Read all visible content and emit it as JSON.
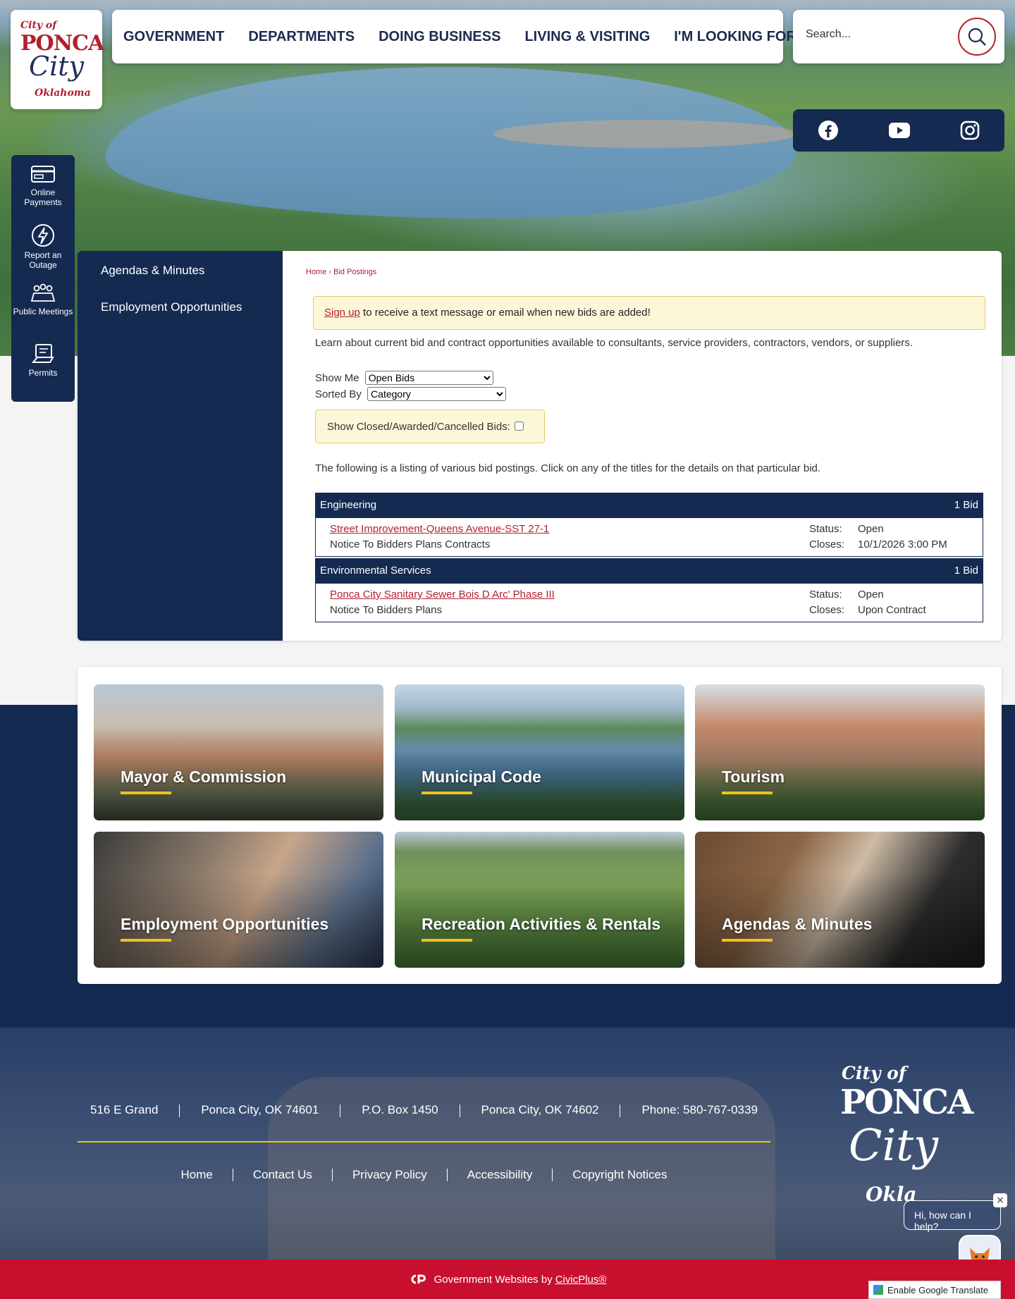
{
  "logo": {
    "line1": "City of",
    "line2": "PONCA",
    "line3": "City",
    "line4": "Oklahoma"
  },
  "nav": [
    "GOVERNMENT",
    "DEPARTMENTS",
    "DOING BUSINESS",
    "LIVING & VISITING",
    "I'M LOOKING FOR"
  ],
  "search": {
    "placeholder": "Search..."
  },
  "social": [
    "facebook-icon",
    "youtube-icon",
    "instagram-icon"
  ],
  "quick": [
    {
      "label": "Online Payments",
      "icon": "credit-card-icon"
    },
    {
      "label": "Report an Outage",
      "icon": "lightning-icon"
    },
    {
      "label": "Public Meetings",
      "icon": "meeting-icon"
    },
    {
      "label": "Permits",
      "icon": "permit-icon"
    }
  ],
  "sidenav": [
    "Agendas & Minutes",
    "Employment Opportunities"
  ],
  "breadcrumb": {
    "home": "Home",
    "sep": "›",
    "current": "Bid Postings"
  },
  "alert": {
    "link": "Sign up",
    "text": " to receive a text message or email when new bids are added!"
  },
  "intro": "Learn about current bid and contract opportunities available to consultants, service providers, contractors, vendors, or suppliers.",
  "controls": {
    "show_label": "Show Me",
    "show_value": "Open Bids",
    "sort_label": "Sorted By",
    "sort_value": "Category",
    "closed_label": "Show Closed/Awarded/Cancelled Bids:"
  },
  "listing_text": "The following is a listing of various bid postings. Click on any of the titles for the details on that particular bid.",
  "categories": [
    {
      "name": "Engineering",
      "count": "1 Bid",
      "bid": {
        "title": "Street Improvement-Queens Avenue-SST 27-1",
        "desc": "Notice To Bidders Plans Contracts",
        "status_label": "Status:",
        "status": "Open",
        "closes_label": "Closes:",
        "closes": "10/1/2026 3:00 PM"
      }
    },
    {
      "name": "Environmental Services",
      "count": "1 Bid",
      "bid": {
        "title": "Ponca City Sanitary Sewer Bois D Arc' Phase III",
        "desc": "Notice To Bidders Plans",
        "status_label": "Status:",
        "status": "Open",
        "closes_label": "Closes:",
        "closes": "Upon Contract"
      }
    }
  ],
  "tiles": [
    "Mayor & Commission",
    "Municipal Code",
    "Tourism",
    "Employment Opportunities",
    "Recreation Activities & Rentals",
    "Agendas & Minutes"
  ],
  "footer": {
    "address": [
      "516 E Grand",
      "Ponca City, OK 74601",
      "P.O. Box 1450",
      "Ponca City, OK 74602",
      "Phone: 580-767-0339"
    ],
    "links": [
      "Home",
      "Contact Us",
      "Privacy Policy",
      "Accessibility",
      "Copyright Notices"
    ],
    "logo": {
      "a": "City of",
      "b": "PONCA",
      "c": "City",
      "d": "Okla"
    }
  },
  "chat": {
    "text": "Hi, how can I help?",
    "close": "×"
  },
  "bottombar": {
    "text": "Government Websites by",
    "link": "CivicPlus®"
  },
  "translate": "Enable Google Translate",
  "colors": {
    "navy": "#142a50",
    "red": "#b2202e",
    "gold": "#f2c01e",
    "alert_bg": "#fdf7d9"
  }
}
